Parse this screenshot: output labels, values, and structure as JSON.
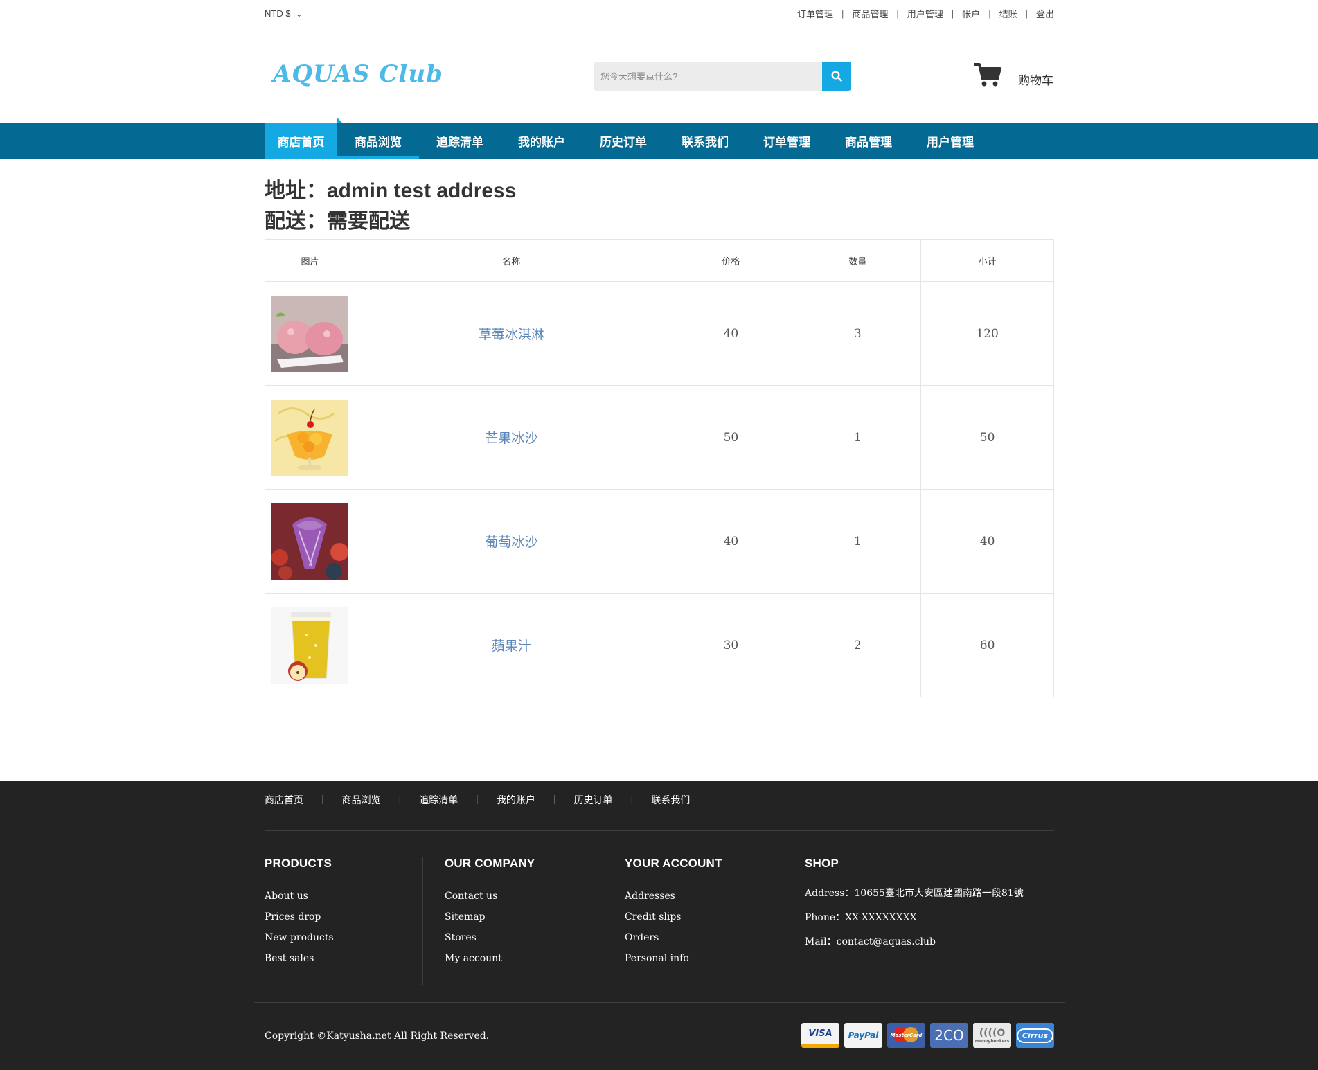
{
  "topbar": {
    "currency": "NTD $",
    "links": [
      "订单管理",
      "商品管理",
      "用户管理",
      "帐户",
      "结账",
      "登出"
    ]
  },
  "header": {
    "logo_text": "AQUAS Club",
    "search_placeholder": "您今天想要点什么?",
    "cart_label": "购物车"
  },
  "nav": {
    "items": [
      "商店首页",
      "商品浏览",
      "追踪清单",
      "我的账户",
      "历史订单",
      "联系我们",
      "订单管理",
      "商品管理",
      "用户管理"
    ]
  },
  "order_info": {
    "address_line": "地址：admin test address",
    "delivery_line": "配送：需要配送"
  },
  "table": {
    "headers": [
      "图片",
      "名称",
      "价格",
      "数量",
      "小计"
    ],
    "rows": [
      {
        "name": "草莓冰淇淋",
        "price": "40",
        "qty": "3",
        "subtotal": "120"
      },
      {
        "name": "芒果冰沙",
        "price": "50",
        "qty": "1",
        "subtotal": "50"
      },
      {
        "name": "葡萄冰沙",
        "price": "40",
        "qty": "1",
        "subtotal": "40"
      },
      {
        "name": "蘋果汁",
        "price": "30",
        "qty": "2",
        "subtotal": "60"
      }
    ]
  },
  "footer": {
    "nav": [
      "商店首页",
      "商品浏览",
      "追踪清单",
      "我的账户",
      "历史订单",
      "联系我们"
    ],
    "columns": [
      {
        "title": "PRODUCTS",
        "links": [
          "About us",
          "Prices drop",
          "New products",
          "Best sales"
        ]
      },
      {
        "title": "OUR COMPANY",
        "links": [
          "Contact us",
          "Sitemap",
          "Stores",
          "My account"
        ]
      },
      {
        "title": "YOUR ACCOUNT",
        "links": [
          "Addresses",
          "Credit slips",
          "Orders",
          "Personal info"
        ]
      },
      {
        "title": "SHOP",
        "links": [
          "Address：10655臺北市大安區建國南路一段81號",
          "Phone：XX-XXXXXXXX",
          "Mail：contact@aquas.club"
        ]
      }
    ],
    "copyright": "Copyright ©Katyusha.net All Right Reserved.",
    "payment_labels": [
      "VISA",
      "PayPal",
      "MasterCard",
      "2CO",
      "moneybookers",
      "Cirrus"
    ]
  },
  "colors": {
    "accent": "#14a9e2",
    "nav_bg": "#046a94",
    "footer_bg": "#232323",
    "logo": "#4cb9e9"
  }
}
